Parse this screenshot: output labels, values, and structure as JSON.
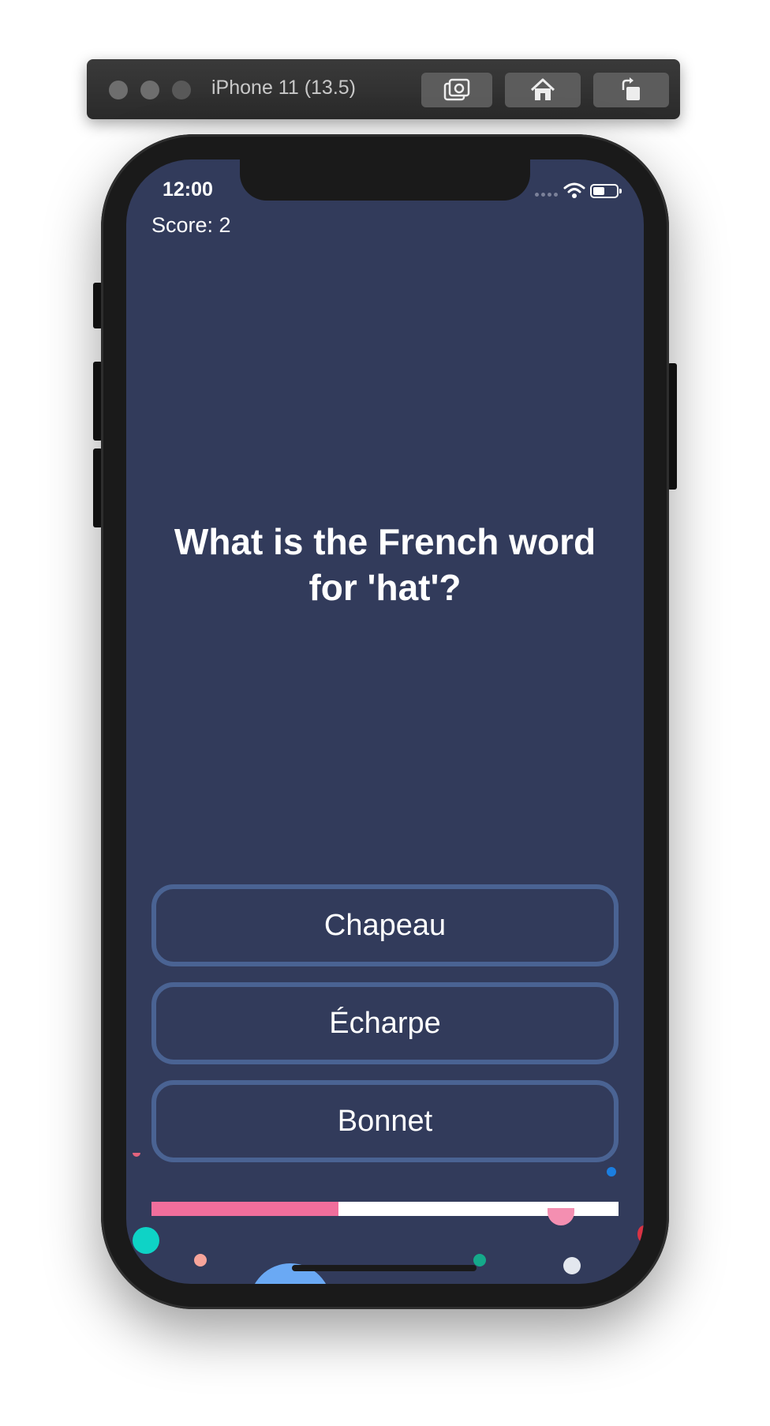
{
  "simulator": {
    "title": "iPhone 11 (13.5)",
    "buttons": [
      "screenshot-icon",
      "home-icon",
      "rotate-icon"
    ]
  },
  "status_bar": {
    "time": "12:00"
  },
  "quiz": {
    "score_label": "Score: 2",
    "question": "What is the French word for 'hat'?",
    "answers": [
      "Chapeau",
      "Écharpe",
      "Bonnet"
    ],
    "progress": 0.4
  },
  "colors": {
    "background": "#323b5b",
    "answer_border": "#4a6393",
    "progress_fill": "#f06e9c",
    "progress_track": "#ffffff"
  }
}
